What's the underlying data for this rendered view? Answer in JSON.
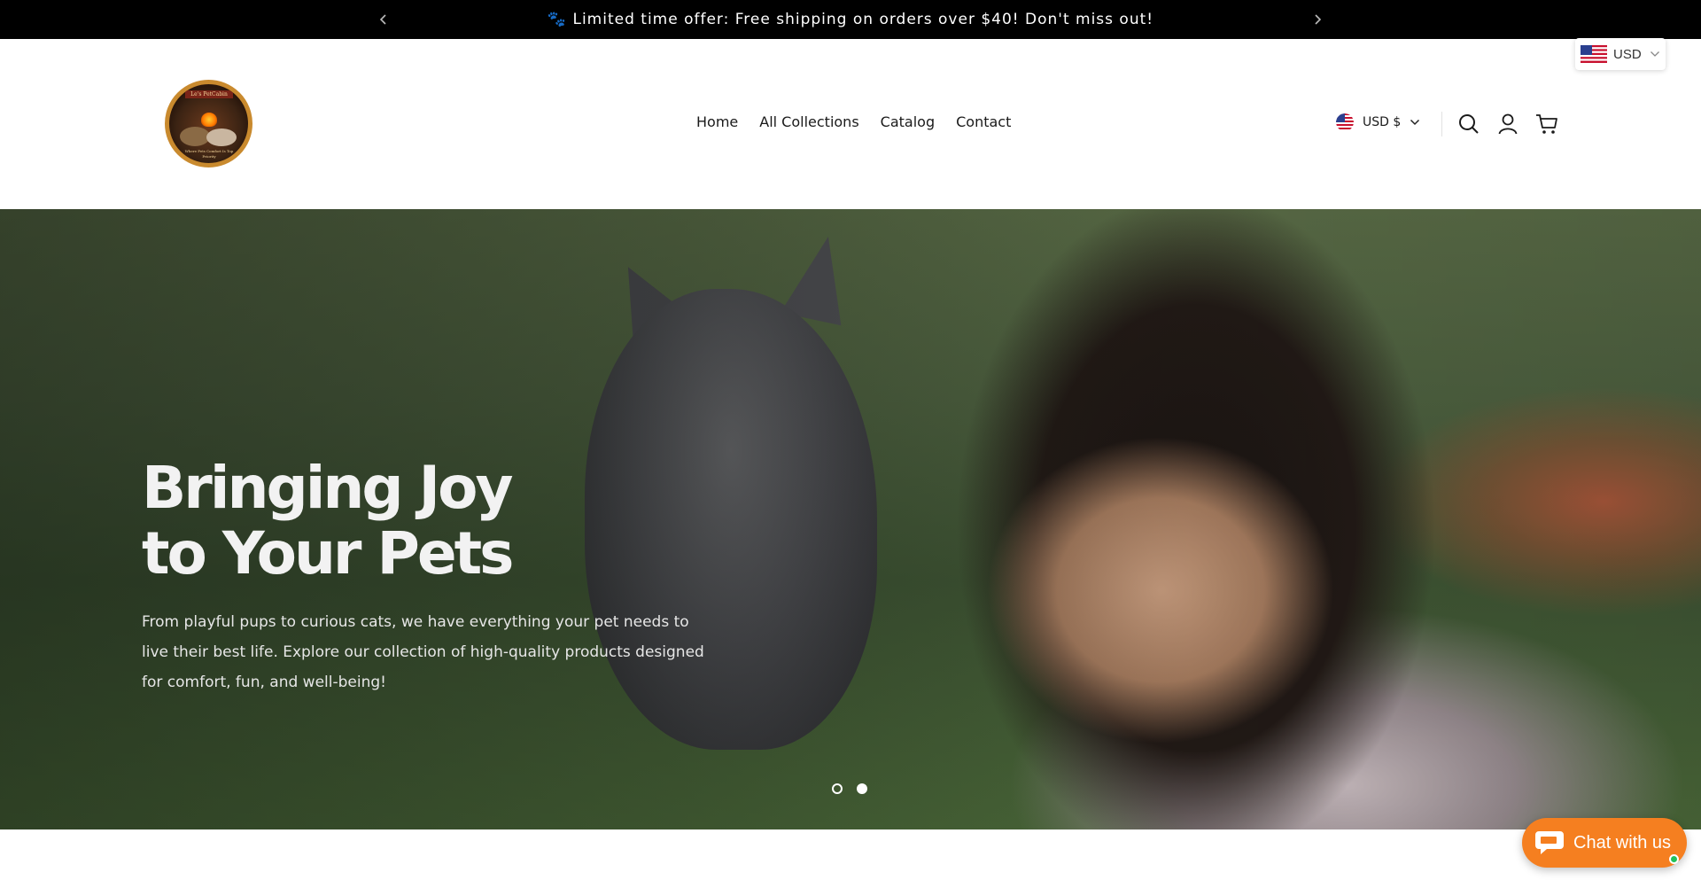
{
  "announcement": {
    "text": "🐾 Limited time offer: Free shipping on orders over $40! Don't miss out!",
    "prev_icon": "chevron-left-icon",
    "next_icon": "chevron-right-icon"
  },
  "currency_widget": {
    "label": "USD",
    "flag_icon": "us-flag-icon"
  },
  "header": {
    "logo": {
      "banner_text": "Le's PetCabin",
      "tagline": "Where Pets Comfort Is Top Priority"
    },
    "nav": [
      "Home",
      "All Collections",
      "Catalog",
      "Contact"
    ],
    "currency_selector": "USD $",
    "icons": [
      "search-icon",
      "account-icon",
      "cart-icon"
    ]
  },
  "hero": {
    "title": "Bringing Joy\nto Your Pets",
    "description": "From playful pups to curious cats, we have everything your pet needs to live their best life. Explore our collection of high-quality products designed for comfort, fun, and well-being!",
    "slides": 2,
    "active_slide": 2
  },
  "chat": {
    "label": "Chat with us",
    "icon": "chat-bubble-icon",
    "status": "online"
  },
  "colors": {
    "announcement_bg": "#000000",
    "chat_accent": "#f57f20",
    "online_dot": "#21c15a"
  }
}
